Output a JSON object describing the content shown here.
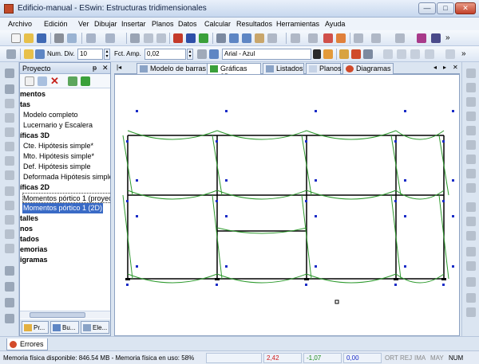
{
  "window": {
    "title": "Edificio-manual - ESwin: Estructuras tridimensionales",
    "min_label": "—",
    "max_label": "□",
    "close_label": "✕"
  },
  "menu": [
    "Archivo",
    "Edición",
    "Ver",
    "Dibujar",
    "Insertar",
    "Planos",
    "Datos",
    "Calcular",
    "Resultados",
    "Herramientas",
    "Ayuda"
  ],
  "toolbar2": {
    "num_div_label": "Num. Div.",
    "num_div_value": "10",
    "fct_amp_label": "Fct. Amp.",
    "fct_amp_value": "0,02",
    "font_value": "Arial - Azul"
  },
  "project": {
    "title": "Proyecto",
    "pin": "ᵽ",
    "close": "✕",
    "tree": [
      {
        "text": "mentos",
        "bold": true
      },
      {
        "text": "tas",
        "bold": true
      },
      {
        "text": "Modelo completo",
        "bold": false
      },
      {
        "text": "Lucernario y Escalera",
        "bold": false
      },
      {
        "text": "íficas 3D",
        "bold": true
      },
      {
        "text": "Cte.  Hipótesis simple*",
        "bold": false
      },
      {
        "text": "Mto. Hipótesis simple*",
        "bold": false
      },
      {
        "text": "Def. Hipótesis simple",
        "bold": false
      },
      {
        "text": "Deformada Hipótesis simple",
        "bold": false
      },
      {
        "text": "íficas 2D",
        "bold": true
      },
      {
        "text": "Momentos pórtico 1 (proyec",
        "bold": false
      },
      {
        "text": "Momentos pórtico 1 (2D)",
        "bold": false
      },
      {
        "text": "talles",
        "bold": true
      },
      {
        "text": "nos",
        "bold": true
      },
      {
        "text": "tados",
        "bold": true
      },
      {
        "text": "emorias",
        "bold": true
      },
      {
        "text": "igramas",
        "bold": true
      }
    ],
    "tabs": [
      "Pr...",
      "Bu...",
      "Ele..."
    ]
  },
  "doc_tabs": [
    "Modelo de barras",
    "Gráficas 2D",
    "Listados",
    "Planos",
    "Diagramas"
  ],
  "errors_tab": "Errores",
  "status": {
    "mem_free": "Memoria física disponible: 846.54 MB - Memoria física en uso: 58%",
    "coord_x": "2,42",
    "coord_y": "-1,07",
    "coord_z": "0,00",
    "flags": [
      "ORT",
      "REJ",
      "IMA",
      "MAY",
      "NUM"
    ]
  },
  "colors": {
    "frame": "#000000",
    "diagram": "#2e9a2e",
    "marker": "#1a2cc7",
    "accent": "#3a6bc6"
  }
}
